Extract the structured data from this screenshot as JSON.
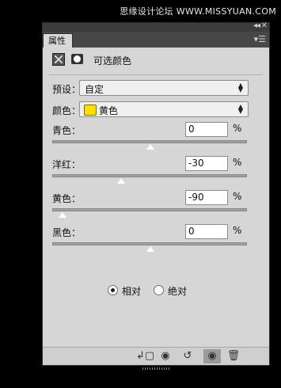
{
  "watermark": "思缘设计论坛 WWW.MISSYUAN.COM",
  "panel": {
    "tab_label": "属性",
    "adjustment_title": "可选颜色",
    "preset": {
      "label": "预设：",
      "value": "自定"
    },
    "colors": {
      "label": "颜色：",
      "value": "黄色",
      "swatch_color": "#ffe000"
    },
    "sliders": [
      {
        "label": "青色：",
        "value": "0",
        "unit": "%",
        "level": 0.0
      },
      {
        "label": "洋红：",
        "value": "-30",
        "unit": "%",
        "level": -0.3
      },
      {
        "label": "黄色：",
        "value": "-90",
        "unit": "%",
        "level": -0.9
      },
      {
        "label": "黑色：",
        "value": "0",
        "unit": "%",
        "level": 0.0
      }
    ],
    "method": {
      "relative_label": "相对",
      "absolute_label": "绝对",
      "selected": "relative"
    }
  }
}
